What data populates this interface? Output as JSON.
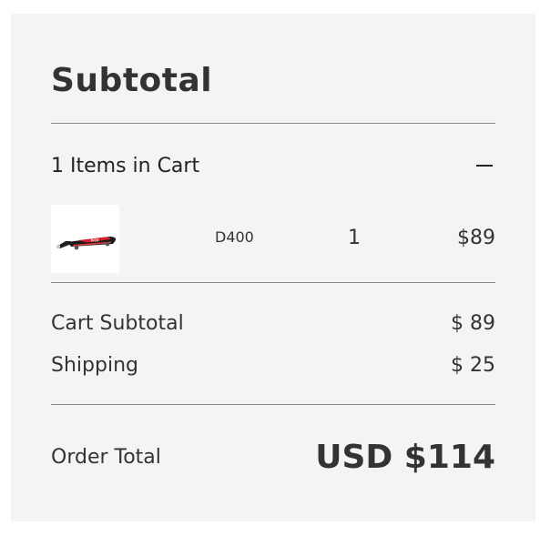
{
  "summary": {
    "title": "Subtotal"
  },
  "cart": {
    "count_label": "1 Items in Cart",
    "collapse_icon": "minus-icon",
    "items": [
      {
        "sku": "D400",
        "quantity": "1",
        "price": "$89",
        "thumbnail_icon": "scooter-deck-image"
      }
    ]
  },
  "totals": {
    "subtotal_label": "Cart Subtotal",
    "subtotal_value": "$ 89",
    "shipping_label": "Shipping",
    "shipping_value": "$ 25",
    "order_total_label": "Order Total",
    "order_total_value": "USD $114"
  },
  "colors": {
    "panel_background": "#f4f4f4",
    "text": "#333333",
    "divider": "#8a8a8a",
    "product_accent_red": "#d4202a"
  }
}
